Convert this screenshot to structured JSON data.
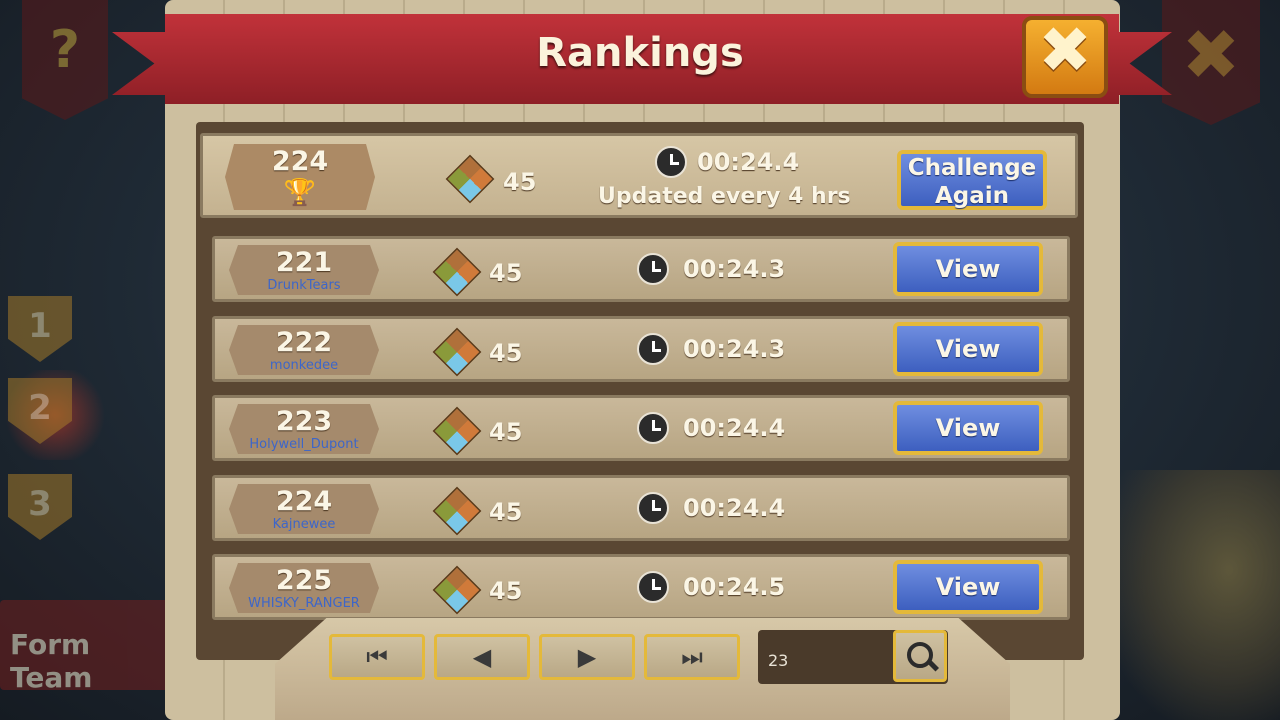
{
  "header": {
    "title": "Rankings"
  },
  "icons": {
    "close": "close-icon",
    "help": "question-icon",
    "trophy": "trophy-icon",
    "power": "cube-power-icon",
    "clock": "clock-icon",
    "search": "search-icon"
  },
  "colors": {
    "ribbon": "#b3262e",
    "button_blue": "#4f6fd0",
    "button_border": "#e4b93a",
    "player_name": "#3d66c9"
  },
  "sidebar": {
    "help_label": "?",
    "tiers": [
      "1",
      "2",
      "3"
    ],
    "form_team_label": "Form Team"
  },
  "my_rank": {
    "rank": "224",
    "power": "45",
    "time": "00:24.4",
    "note": "Updated every 4 hrs",
    "button_label": "Challenge\nAgain"
  },
  "rows": [
    {
      "rank": "221",
      "player": "DrunkTears",
      "power": "45",
      "time": "00:24.3",
      "button_label": "View"
    },
    {
      "rank": "222",
      "player": "monkedee",
      "power": "45",
      "time": "00:24.3",
      "button_label": "View"
    },
    {
      "rank": "223",
      "player": "Holywell_Dupont",
      "power": "45",
      "time": "00:24.4",
      "button_label": "View"
    },
    {
      "rank": "224",
      "player": "Kajnewee",
      "power": "45",
      "time": "00:24.4",
      "button_label": ""
    },
    {
      "rank": "225",
      "player": "WHISKY_RANGER",
      "power": "45",
      "time": "00:24.5",
      "button_label": "View"
    }
  ],
  "pager": {
    "first": "⏮",
    "prev": "◀",
    "next": "▶",
    "last": "⏭"
  },
  "search": {
    "value": "23"
  }
}
